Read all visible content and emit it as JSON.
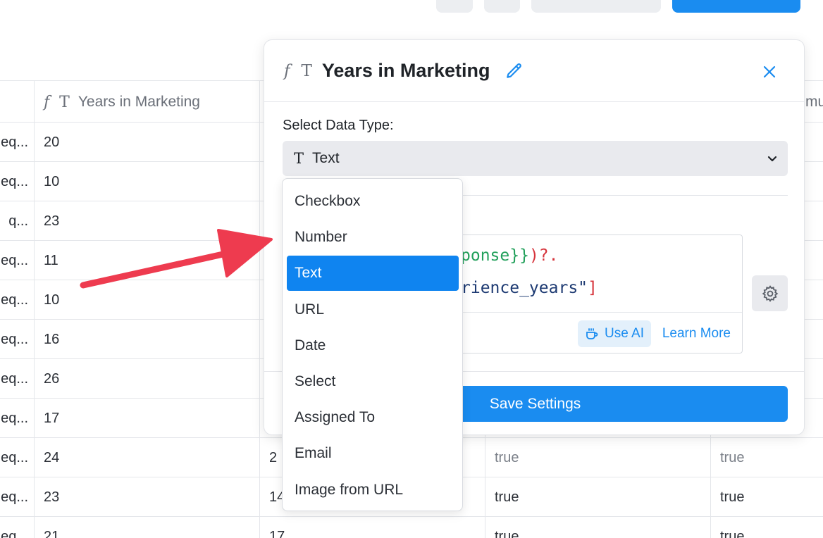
{
  "colors": {
    "accent": "#1a8cf0",
    "menu_active": "#0f84f0",
    "arrow": "#ee3b4f",
    "code_green": "#22a05b",
    "code_navy": "#1d3a72",
    "code_red": "#d6333b"
  },
  "table": {
    "column_header": "Years in Marketing",
    "left_cell_fragments": [
      "eq...",
      "eq...",
      "q...",
      "eq...",
      "eq...",
      "eq...",
      "eq...",
      "eq...",
      "eq...",
      "eq...",
      "eq..."
    ],
    "years": [
      "20",
      "10",
      "23",
      "11",
      "10",
      "16",
      "26",
      "17",
      "24",
      "23",
      "21"
    ],
    "col3": [
      "",
      "",
      "",
      "",
      "",
      "",
      "",
      "",
      "2",
      "14",
      "17"
    ],
    "col4": [
      "",
      "",
      "",
      "",
      "",
      "",
      "",
      "",
      "true",
      "true",
      "true"
    ],
    "col5": [
      "",
      "",
      "",
      "",
      "",
      "",
      "",
      "",
      "true",
      "true",
      "true"
    ],
    "header_fragment_right": "mu"
  },
  "panel": {
    "title": "Years in Marketing",
    "data_type_label": "Select Data Type:",
    "selected_type": "Text",
    "code_line1": "ponse}})?.",
    "code_line2": "rience_years\"]",
    "use_ai": "Use AI",
    "learn_more": "Learn More",
    "save_label": "Save Settings"
  },
  "menu": {
    "items": [
      "Checkbox",
      "Number",
      "Text",
      "URL",
      "Date",
      "Select",
      "Assigned To",
      "Email",
      "Image from URL"
    ],
    "active_index": 2
  }
}
